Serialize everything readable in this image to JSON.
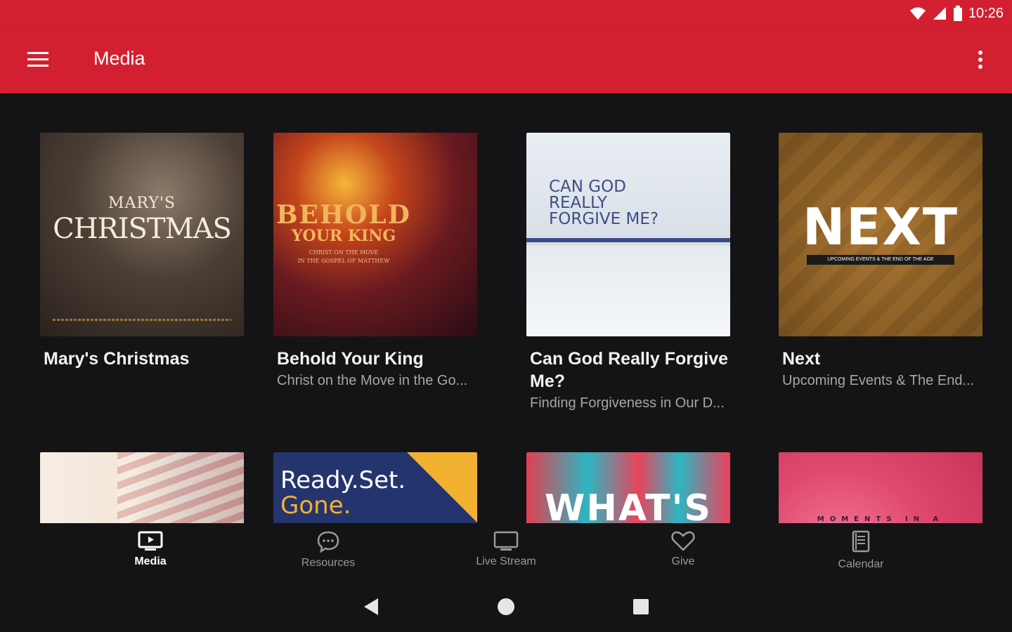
{
  "status": {
    "time": "10:26"
  },
  "appbar": {
    "title": "Media"
  },
  "colors": {
    "primary": "#d32030",
    "background": "#141416",
    "subtitle": "#a6a6a6"
  },
  "media": [
    {
      "title": "Mary's Christmas",
      "subtitle": "",
      "art": {
        "line1": "MARY'S",
        "line2": "CHRISTMAS"
      }
    },
    {
      "title": "Behold Your King",
      "subtitle": "Christ on the Move in the Go...",
      "art": {
        "line1": "BEHOLD",
        "line2": "YOUR KING",
        "line3": "CHRIST ON THE MOVE",
        "line4": "IN THE GOSPEL OF MATTHEW"
      }
    },
    {
      "title": "Can God Really Forgive Me?",
      "subtitle": "Finding Forgiveness in Our D...",
      "art": {
        "line1": "CAN GOD",
        "line2": "REALLY",
        "line3": "FORGIVE ME?"
      }
    },
    {
      "title": "Next",
      "subtitle": "Upcoming Events & The End...",
      "art": {
        "line1": "NEXT",
        "line2": "UPCOMING EVENTS & THE END OF THE AGE"
      }
    },
    {
      "title": "",
      "subtitle": ""
    },
    {
      "title": "",
      "subtitle": "",
      "art": {
        "line1": "Ready.Set.",
        "line2": "Gone."
      }
    },
    {
      "title": "",
      "subtitle": "",
      "art": {
        "line1": "WHAT'S"
      }
    },
    {
      "title": "",
      "subtitle": "",
      "art": {
        "line1": "MOMENTS IN A"
      }
    }
  ],
  "bottom_nav": [
    {
      "label": "Media",
      "icon": "tv-play-icon",
      "active": true
    },
    {
      "label": "Resources",
      "icon": "chat-bubble-icon",
      "active": false
    },
    {
      "label": "Live Stream",
      "icon": "monitor-icon",
      "active": false
    },
    {
      "label": "Give",
      "icon": "heart-icon",
      "active": false
    },
    {
      "label": "Calendar",
      "icon": "book-icon",
      "active": false
    }
  ]
}
